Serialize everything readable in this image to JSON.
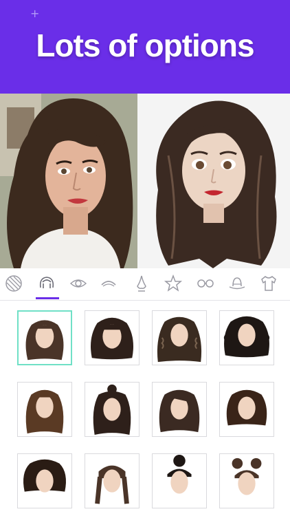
{
  "banner": {
    "headline": "Lots of options",
    "background_color": "#6a2ee8"
  },
  "tabs": [
    {
      "name": "skin-tone",
      "icon": "striped-circle-icon",
      "selected": false
    },
    {
      "name": "hair",
      "icon": "hair-icon",
      "selected": true
    },
    {
      "name": "eyes",
      "icon": "eye-icon",
      "selected": false
    },
    {
      "name": "eyebrows",
      "icon": "eyebrow-icon",
      "selected": false
    },
    {
      "name": "nose",
      "icon": "nose-icon",
      "selected": false
    },
    {
      "name": "favorites",
      "icon": "star-icon",
      "selected": false
    },
    {
      "name": "glasses",
      "icon": "glasses-icon",
      "selected": false
    },
    {
      "name": "hat",
      "icon": "hat-icon",
      "selected": false
    },
    {
      "name": "clothing",
      "icon": "tshirt-icon",
      "selected": false
    }
  ],
  "hair_options": [
    {
      "style": "long-wavy",
      "selected": true
    },
    {
      "style": "long-curly",
      "selected": false
    },
    {
      "style": "long-crimped",
      "selected": false
    },
    {
      "style": "voluminous-curly",
      "selected": false
    },
    {
      "style": "braids-long",
      "selected": false
    },
    {
      "style": "half-up-bun",
      "selected": false
    },
    {
      "style": "long-layered",
      "selected": false
    },
    {
      "style": "shoulder-bob",
      "selected": false
    },
    {
      "style": "short-curly",
      "selected": false
    },
    {
      "style": "braided-pigtails",
      "selected": false
    },
    {
      "style": "top-bun",
      "selected": false
    },
    {
      "style": "space-buns",
      "selected": false
    }
  ],
  "colors": {
    "accent": "#6a2ee8",
    "selection": "#6fe0c6",
    "hair_dark": "#3b2a22",
    "skin": "#f0d4c0"
  }
}
